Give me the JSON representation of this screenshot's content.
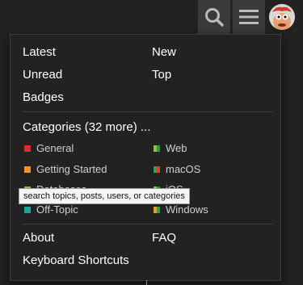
{
  "header": {
    "search_icon": "search-icon",
    "menu_icon": "hamburger-icon",
    "avatar": "user-avatar"
  },
  "menu": {
    "links_top": {
      "latest": "Latest",
      "new": "New",
      "unread": "Unread",
      "top": "Top",
      "badges": "Badges"
    },
    "categories_header": "Categories (32 more) ...",
    "categories": [
      {
        "label": "General",
        "color": "#e02a2a"
      },
      {
        "label": "Web",
        "colors": [
          "#8fc23a",
          "#2a9a3a"
        ]
      },
      {
        "label": "Getting Started",
        "color": "#f39422"
      },
      {
        "label": "macOS",
        "colors": [
          "#2ba34b",
          "#e63b2e"
        ]
      },
      {
        "label": "Databases",
        "color": "#9dbd2b"
      },
      {
        "label": "iOS",
        "colors": [
          "#8fc23a",
          "#2a9a3a"
        ]
      },
      {
        "label": "Off-Topic",
        "color": "#12a89d"
      },
      {
        "label": "Windows",
        "colors": [
          "#f7941d",
          "#2ba34b"
        ]
      }
    ],
    "links_bottom": {
      "about": "About",
      "faq": "FAQ",
      "keyboard": "Keyboard Shortcuts"
    }
  },
  "tooltip": "search topics, posts, users, or categories"
}
